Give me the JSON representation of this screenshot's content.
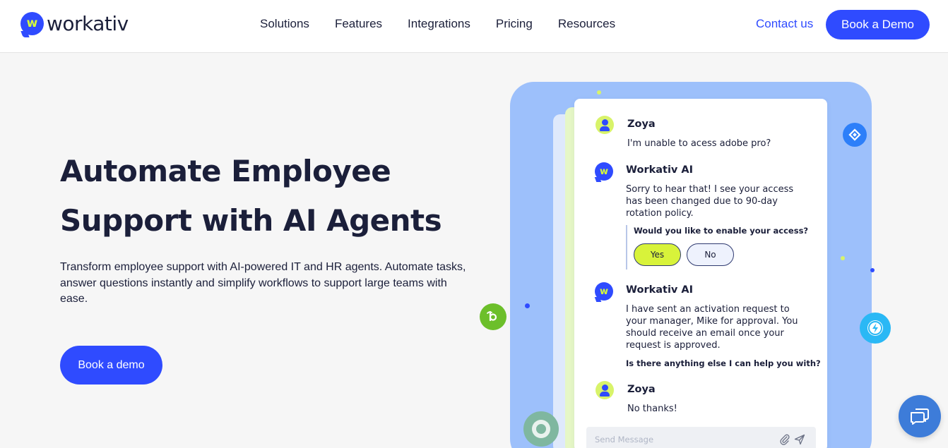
{
  "brand": {
    "logo_letter": "w",
    "name": "workativ",
    "color": "#2f4bff",
    "accent": "#d8ff3a"
  },
  "nav": {
    "items": [
      {
        "label": "Solutions"
      },
      {
        "label": "Features"
      },
      {
        "label": "Integrations"
      },
      {
        "label": "Pricing"
      },
      {
        "label": "Resources"
      }
    ],
    "contact_label": "Contact us",
    "book_demo_label": "Book a Demo"
  },
  "hero": {
    "title_line1": "Automate Employee",
    "title_line2": "Support with AI Agents",
    "subtitle": "Transform employee support with AI-powered IT and HR agents. Automate tasks, answer questions instantly and simplify workflows to support large teams with ease.",
    "cta_label": "Book a demo"
  },
  "chat": {
    "messages": [
      {
        "sender": "Zoya",
        "text": "I'm unable to acess adobe pro?"
      },
      {
        "sender": "Workativ AI",
        "text_lines": [
          "Sorry to hear that! I see your access",
          "has been changed due to 90-day",
          "rotation policy."
        ]
      },
      {
        "sender": "Workativ AI",
        "text_lines": [
          "I have sent an activation request to",
          "your manager, Mike for approval. You",
          "should receive an email once your",
          "request is approved."
        ]
      },
      {
        "sender": "Zoya",
        "text": "No thanks!"
      }
    ],
    "question": "Would you like to enable your access?",
    "yes_label": "Yes",
    "no_label": "No",
    "followup": "Is there anything else I can help you with?",
    "input_placeholder": "Send Message"
  },
  "integration_icons": [
    "jira-icon",
    "bamboohr-icon",
    "zapier-icon",
    "agent-avatar-icon"
  ],
  "chat_widget_icon": "chat-bubbles-icon"
}
